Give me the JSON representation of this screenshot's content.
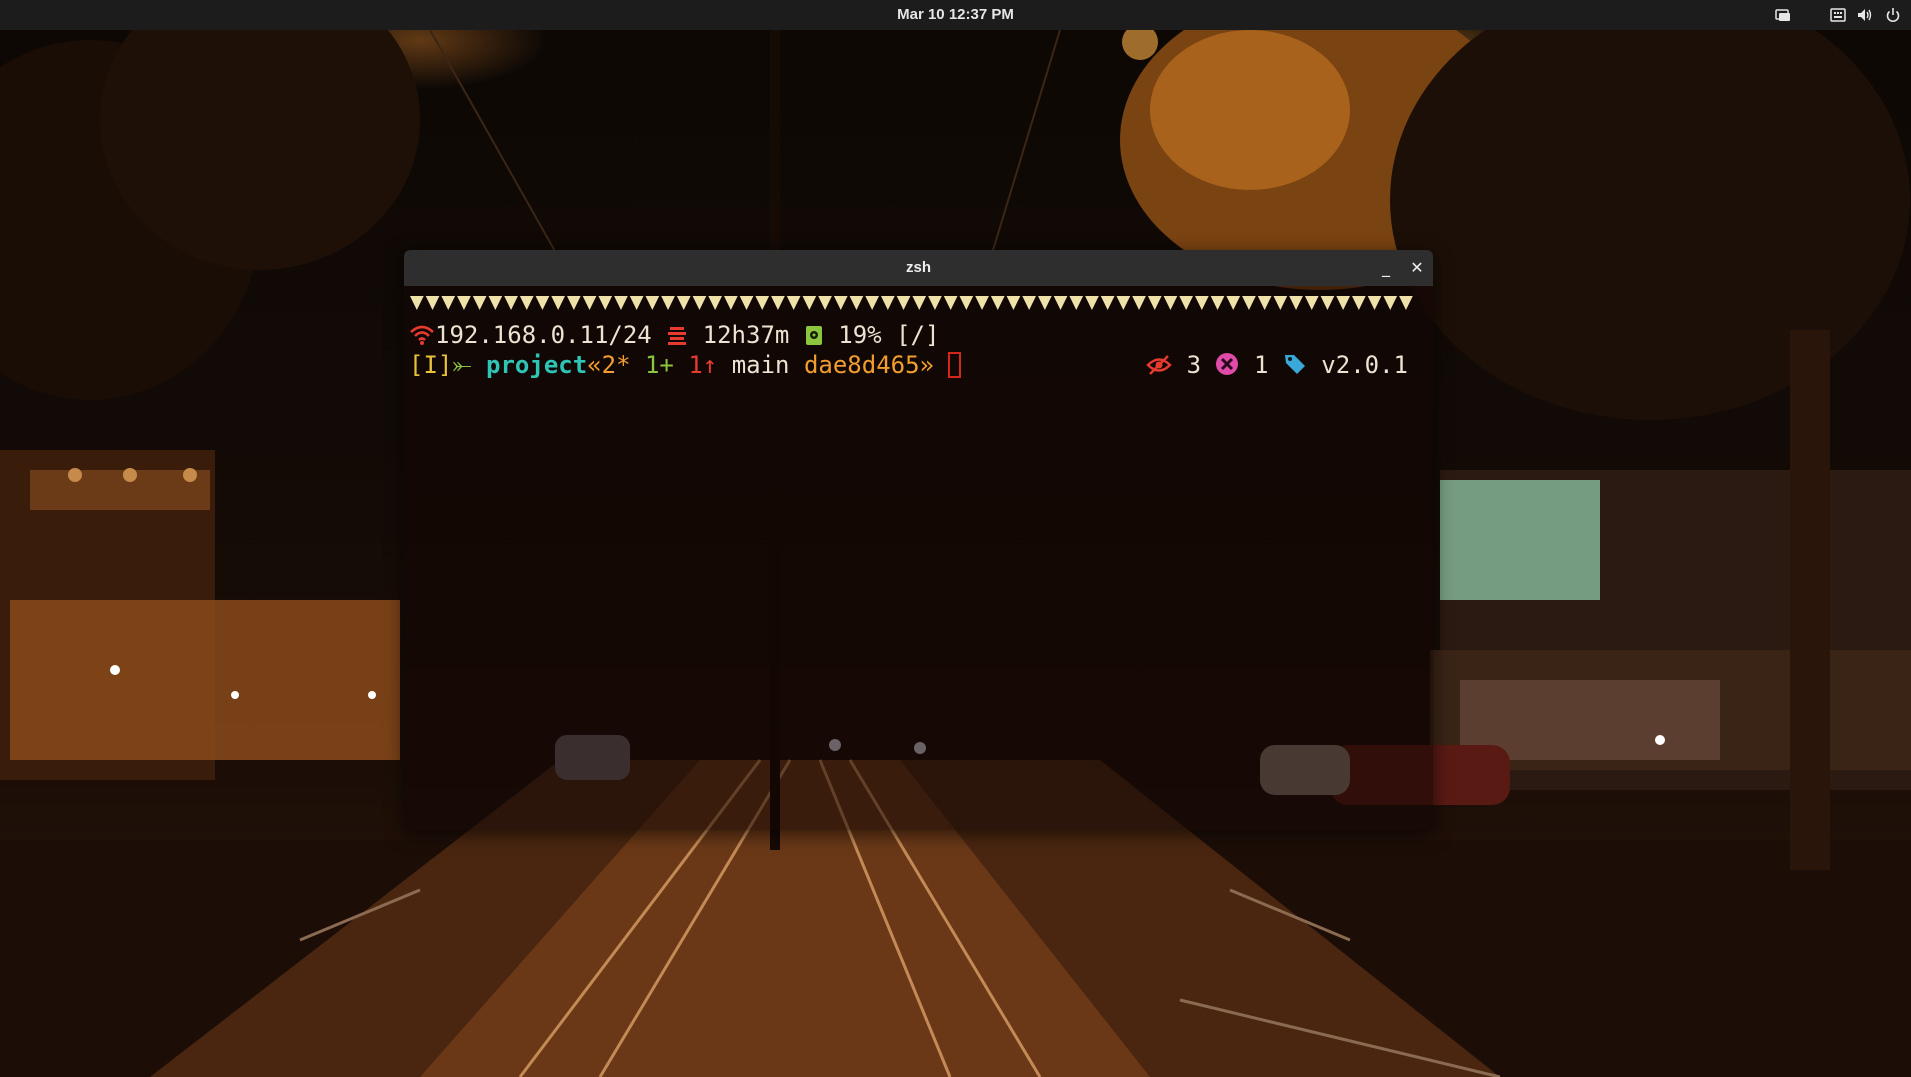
{
  "topbar": {
    "clock": "Mar 10  12:37 PM",
    "tray_icons": [
      "screen-share-icon",
      "keyboard-icon",
      "volume-icon",
      "power-icon"
    ]
  },
  "window": {
    "title": "zsh",
    "minimize_label": "_",
    "close_label": "✕"
  },
  "prompt": {
    "network": "192.168.0.11/24",
    "uptime": "12h37m",
    "disk": "19%",
    "cwd": "[/]",
    "vi_mode": "[I]",
    "vi_arrow": "⤜",
    "repo": "project",
    "git_open": "«",
    "git_modified": "2*",
    "git_staged": "1+",
    "git_ahead": "1↑",
    "branch": "main",
    "commit": "dae8d465",
    "git_close": "»",
    "right": {
      "watchers": "3",
      "errors": "1",
      "tag": "v2.0.1"
    }
  },
  "colors": {
    "red": "#e63b2e",
    "green": "#8cc63f",
    "teal": "#2ec4b6",
    "orange": "#f29e2e",
    "yellow": "#e8c33b",
    "triangle": "#efe2a8"
  }
}
